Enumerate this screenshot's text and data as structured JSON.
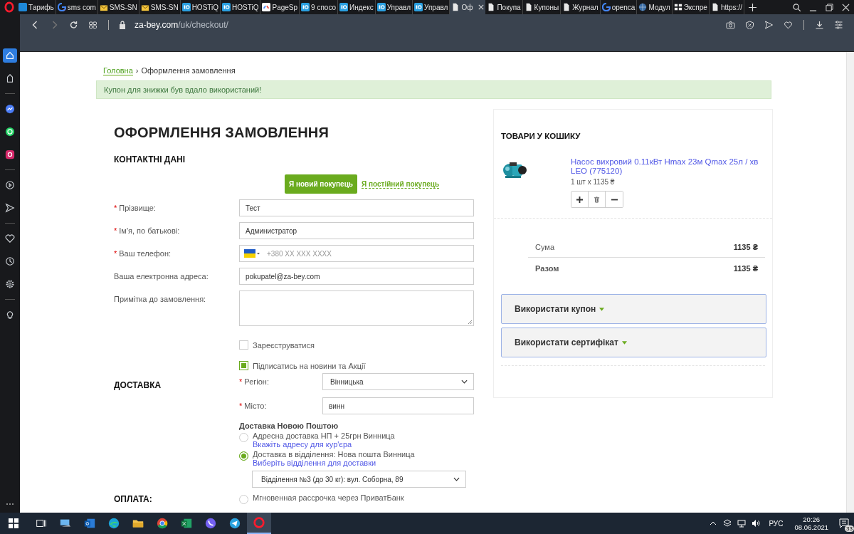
{
  "browser": {
    "tabs": [
      {
        "title": "Тарифь",
        "kind": "letter",
        "selected": false
      },
      {
        "title": "sms com",
        "kind": "google",
        "selected": false
      },
      {
        "title": "SMS-SN",
        "kind": "envelope",
        "selected": false
      },
      {
        "title": "SMS-SN",
        "kind": "envelope",
        "selected": false
      },
      {
        "title": "HOSTiQ",
        "kind": "square",
        "selected": false
      },
      {
        "title": "HOSTiQ",
        "kind": "square",
        "selected": false
      },
      {
        "title": "PageSp",
        "kind": "pagespeed",
        "selected": false
      },
      {
        "title": "9 спосо",
        "kind": "square",
        "selected": false
      },
      {
        "title": "Индекс",
        "kind": "square",
        "selected": false
      },
      {
        "title": "Управл",
        "kind": "square",
        "selected": false
      },
      {
        "title": "Управл",
        "kind": "square",
        "selected": false
      },
      {
        "title": "Оф",
        "kind": "page",
        "selected": true
      },
      {
        "title": "Покупа",
        "kind": "page",
        "selected": false
      },
      {
        "title": "Купоны",
        "kind": "page",
        "selected": false
      },
      {
        "title": "Журнал",
        "kind": "page",
        "selected": false
      },
      {
        "title": "openca",
        "kind": "google",
        "selected": false
      },
      {
        "title": "Модул",
        "kind": "globe",
        "selected": false
      },
      {
        "title": "Экспре",
        "kind": "grid",
        "selected": false
      },
      {
        "title": "https://",
        "kind": "page",
        "selected": false
      }
    ],
    "address": {
      "domain": "za-bey.com",
      "path": "/uk/checkout/"
    },
    "sidebar": [
      {
        "kind": "home",
        "selected": true
      },
      {
        "kind": "star",
        "selected": false
      },
      {
        "kind": "messenger",
        "selected": false
      },
      {
        "kind": "whatsapp",
        "selected": false
      },
      {
        "kind": "instagram",
        "selected": false
      },
      {
        "kind": "player",
        "selected": false
      },
      {
        "kind": "send",
        "selected": false
      },
      {
        "kind": "heart",
        "selected": false
      },
      {
        "kind": "clock",
        "selected": false
      },
      {
        "kind": "settings",
        "selected": false
      },
      {
        "kind": "bulb",
        "selected": false
      }
    ]
  },
  "page": {
    "breadcrumb": {
      "home": "Головна",
      "separator": "›",
      "current": "Оформлення замовлення"
    },
    "alert": "Купон для знижки був вдало використаний!",
    "title": "ОФОРМЛЕННЯ ЗАМОВЛЕННЯ",
    "contacts": {
      "heading": "КОНТАКТНІ ДАНІ",
      "customer_types": [
        {
          "label": "Я новий покупець",
          "selected": true
        },
        {
          "label": "Я постійний покупець",
          "selected": false
        }
      ],
      "fields": [
        {
          "kind": "text",
          "required_mark": "*",
          "label": "Прізвище:",
          "value": "Тест"
        },
        {
          "kind": "text",
          "required_mark": "*",
          "label": "Ім'я, по батькові:",
          "value": "Администратор"
        },
        {
          "kind": "phone",
          "required_mark": "*",
          "label": "Ваш телефон:",
          "placeholder": "+380 XX XXX XXXX"
        },
        {
          "kind": "text",
          "label": "Ваша електронна адреса:",
          "value": "pokupatel@za-bey.com"
        },
        {
          "kind": "textarea",
          "label": "Примітка до замовлення:"
        }
      ],
      "checkboxes": [
        {
          "label": "Зареєструватися",
          "checked": false
        },
        {
          "label": "Підписатись на новини та Акції",
          "checked": true
        }
      ]
    },
    "delivery": {
      "heading": "ДОСТАВКА",
      "fields": [
        {
          "kind": "select",
          "required_mark": "*",
          "label": "Регіон:",
          "value": "Вінницька"
        },
        {
          "kind": "text",
          "required_mark": "*",
          "label": "Місто:",
          "value": "винн"
        }
      ],
      "method_title": "Доставка Новою Поштою",
      "options": [
        {
          "text": "Адресна доставкa НП + 25грн Винница",
          "link": "Вкажіть адресу для кур'єра",
          "selected": false
        },
        {
          "text": "Доставка в відділення: Нова пошта Винница",
          "link": "Виберіть відділення для доставки",
          "selected": true
        }
      ],
      "branch": "Відділення №3 (до 30 кг): вул. Соборна, 89"
    },
    "payment": {
      "heading": "ОПЛАТА:",
      "options": [
        {
          "text": "Мгновенная рассрочка через ПриватБанк",
          "selected": false
        }
      ]
    }
  },
  "cart": {
    "heading": "ТОВАРИ У КОШИКУ",
    "item": {
      "name": "Насос вихровий 0.11кВт Hmax 23м Qmax 25л / хв LEO (775120)",
      "quantity": "1 шт x 1135 ₴"
    },
    "totals": [
      {
        "kind": "subtotal",
        "label": "Сума",
        "value": "1135 ₴"
      },
      {
        "kind": "total",
        "label": "Разом",
        "value": "1135 ₴"
      }
    ],
    "accordions": [
      "Використати купон",
      "Використати сертифікат"
    ]
  },
  "taskbar": {
    "apps": [
      {
        "kind": "taskview",
        "active": false
      },
      {
        "kind": "computer",
        "active": false
      },
      {
        "kind": "outlook",
        "active": false
      },
      {
        "kind": "edge",
        "active": false
      },
      {
        "kind": "folder",
        "active": false
      },
      {
        "kind": "chrome",
        "active": false
      },
      {
        "kind": "excel",
        "active": false
      },
      {
        "kind": "viber",
        "active": false
      },
      {
        "kind": "telegram",
        "active": false
      },
      {
        "kind": "opera",
        "active": true
      }
    ],
    "language": "РУС",
    "time": "20:26",
    "date": "08.06.2021",
    "notifications": "33"
  }
}
